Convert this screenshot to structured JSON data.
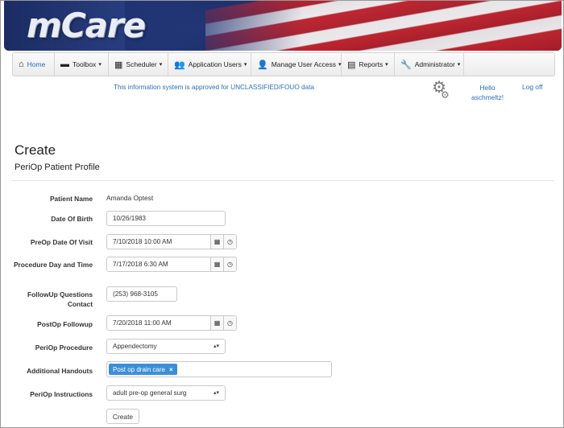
{
  "brand": {
    "logo_text": "mCare"
  },
  "nav": {
    "items": [
      {
        "label": "Home",
        "icon": "home-icon",
        "glyph": "⌂",
        "caret": ""
      },
      {
        "label": "Toolbox",
        "icon": "briefcase-icon",
        "glyph": "▬",
        "caret": "▾"
      },
      {
        "label": "Scheduler",
        "icon": "calendar-icon",
        "glyph": "▦",
        "caret": "▾"
      },
      {
        "label": "Application Users",
        "icon": "users-icon",
        "glyph": "👥",
        "caret": "▾"
      },
      {
        "label": "Manage User Access",
        "icon": "user-icon",
        "glyph": "👤",
        "caret": "▾"
      },
      {
        "label": "Reports",
        "icon": "document-icon",
        "glyph": "▤",
        "caret": "▾"
      },
      {
        "label": "Administrator",
        "icon": "wrench-icon",
        "glyph": "🔧",
        "caret": "▾"
      }
    ]
  },
  "header": {
    "notice": "This information system is approved for UNCLASSIFIED/FOUO data",
    "hello": "Hello aschmeltz!",
    "logoff": "Log off"
  },
  "page": {
    "title": "Create",
    "subtitle": "PeriOp Patient Profile"
  },
  "form": {
    "patient_name_label": "Patient Name",
    "patient_name_value": "Amanda Optest",
    "dob_label": "Date Of Birth",
    "dob_value": "10/26/1983",
    "preop_visit_label": "PreOp Date Of Visit",
    "preop_visit_value": "7/10/2018 10:00 AM",
    "procedure_day_label": "Procedure Day and Time",
    "procedure_day_value": "7/17/2018 6:30 AM",
    "followup_contact_label": "FollowUp Questions Contact",
    "followup_contact_value": "(253) 968-3105",
    "postop_followup_label": "PostOp Followup",
    "postop_followup_value": "7/20/2018 11:00 AM",
    "periop_procedure_label": "PeriOp Procedure",
    "periop_procedure_value": "Appendectomy",
    "handouts_label": "Additional Handouts",
    "handouts_tag": "Post op drain care",
    "tag_remove": "×",
    "instructions_label": "PeriOp Instructions",
    "instructions_value": "adult pre-op general surg",
    "create_button": "Create"
  },
  "icons": {
    "calendar_glyph": "▦",
    "clock_glyph": "◷",
    "select_arrows": "▴▾"
  }
}
